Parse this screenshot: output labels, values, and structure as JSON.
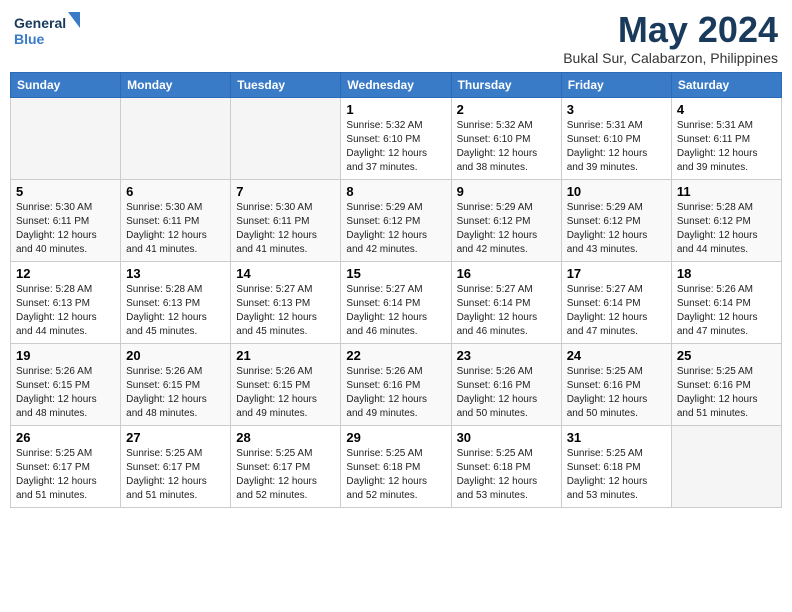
{
  "header": {
    "logo_line1": "General",
    "logo_line2": "Blue",
    "month_title": "May 2024",
    "location": "Bukal Sur, Calabarzon, Philippines"
  },
  "weekdays": [
    "Sunday",
    "Monday",
    "Tuesday",
    "Wednesday",
    "Thursday",
    "Friday",
    "Saturday"
  ],
  "weeks": [
    [
      {
        "day": "",
        "sunrise": "",
        "sunset": "",
        "daylight": "",
        "empty": true
      },
      {
        "day": "",
        "sunrise": "",
        "sunset": "",
        "daylight": "",
        "empty": true
      },
      {
        "day": "",
        "sunrise": "",
        "sunset": "",
        "daylight": "",
        "empty": true
      },
      {
        "day": "1",
        "sunrise": "Sunrise: 5:32 AM",
        "sunset": "Sunset: 6:10 PM",
        "daylight": "Daylight: 12 hours and 37 minutes."
      },
      {
        "day": "2",
        "sunrise": "Sunrise: 5:32 AM",
        "sunset": "Sunset: 6:10 PM",
        "daylight": "Daylight: 12 hours and 38 minutes."
      },
      {
        "day": "3",
        "sunrise": "Sunrise: 5:31 AM",
        "sunset": "Sunset: 6:10 PM",
        "daylight": "Daylight: 12 hours and 39 minutes."
      },
      {
        "day": "4",
        "sunrise": "Sunrise: 5:31 AM",
        "sunset": "Sunset: 6:11 PM",
        "daylight": "Daylight: 12 hours and 39 minutes."
      }
    ],
    [
      {
        "day": "5",
        "sunrise": "Sunrise: 5:30 AM",
        "sunset": "Sunset: 6:11 PM",
        "daylight": "Daylight: 12 hours and 40 minutes."
      },
      {
        "day": "6",
        "sunrise": "Sunrise: 5:30 AM",
        "sunset": "Sunset: 6:11 PM",
        "daylight": "Daylight: 12 hours and 41 minutes."
      },
      {
        "day": "7",
        "sunrise": "Sunrise: 5:30 AM",
        "sunset": "Sunset: 6:11 PM",
        "daylight": "Daylight: 12 hours and 41 minutes."
      },
      {
        "day": "8",
        "sunrise": "Sunrise: 5:29 AM",
        "sunset": "Sunset: 6:12 PM",
        "daylight": "Daylight: 12 hours and 42 minutes."
      },
      {
        "day": "9",
        "sunrise": "Sunrise: 5:29 AM",
        "sunset": "Sunset: 6:12 PM",
        "daylight": "Daylight: 12 hours and 42 minutes."
      },
      {
        "day": "10",
        "sunrise": "Sunrise: 5:29 AM",
        "sunset": "Sunset: 6:12 PM",
        "daylight": "Daylight: 12 hours and 43 minutes."
      },
      {
        "day": "11",
        "sunrise": "Sunrise: 5:28 AM",
        "sunset": "Sunset: 6:12 PM",
        "daylight": "Daylight: 12 hours and 44 minutes."
      }
    ],
    [
      {
        "day": "12",
        "sunrise": "Sunrise: 5:28 AM",
        "sunset": "Sunset: 6:13 PM",
        "daylight": "Daylight: 12 hours and 44 minutes."
      },
      {
        "day": "13",
        "sunrise": "Sunrise: 5:28 AM",
        "sunset": "Sunset: 6:13 PM",
        "daylight": "Daylight: 12 hours and 45 minutes."
      },
      {
        "day": "14",
        "sunrise": "Sunrise: 5:27 AM",
        "sunset": "Sunset: 6:13 PM",
        "daylight": "Daylight: 12 hours and 45 minutes."
      },
      {
        "day": "15",
        "sunrise": "Sunrise: 5:27 AM",
        "sunset": "Sunset: 6:14 PM",
        "daylight": "Daylight: 12 hours and 46 minutes."
      },
      {
        "day": "16",
        "sunrise": "Sunrise: 5:27 AM",
        "sunset": "Sunset: 6:14 PM",
        "daylight": "Daylight: 12 hours and 46 minutes."
      },
      {
        "day": "17",
        "sunrise": "Sunrise: 5:27 AM",
        "sunset": "Sunset: 6:14 PM",
        "daylight": "Daylight: 12 hours and 47 minutes."
      },
      {
        "day": "18",
        "sunrise": "Sunrise: 5:26 AM",
        "sunset": "Sunset: 6:14 PM",
        "daylight": "Daylight: 12 hours and 47 minutes."
      }
    ],
    [
      {
        "day": "19",
        "sunrise": "Sunrise: 5:26 AM",
        "sunset": "Sunset: 6:15 PM",
        "daylight": "Daylight: 12 hours and 48 minutes."
      },
      {
        "day": "20",
        "sunrise": "Sunrise: 5:26 AM",
        "sunset": "Sunset: 6:15 PM",
        "daylight": "Daylight: 12 hours and 48 minutes."
      },
      {
        "day": "21",
        "sunrise": "Sunrise: 5:26 AM",
        "sunset": "Sunset: 6:15 PM",
        "daylight": "Daylight: 12 hours and 49 minutes."
      },
      {
        "day": "22",
        "sunrise": "Sunrise: 5:26 AM",
        "sunset": "Sunset: 6:16 PM",
        "daylight": "Daylight: 12 hours and 49 minutes."
      },
      {
        "day": "23",
        "sunrise": "Sunrise: 5:26 AM",
        "sunset": "Sunset: 6:16 PM",
        "daylight": "Daylight: 12 hours and 50 minutes."
      },
      {
        "day": "24",
        "sunrise": "Sunrise: 5:25 AM",
        "sunset": "Sunset: 6:16 PM",
        "daylight": "Daylight: 12 hours and 50 minutes."
      },
      {
        "day": "25",
        "sunrise": "Sunrise: 5:25 AM",
        "sunset": "Sunset: 6:16 PM",
        "daylight": "Daylight: 12 hours and 51 minutes."
      }
    ],
    [
      {
        "day": "26",
        "sunrise": "Sunrise: 5:25 AM",
        "sunset": "Sunset: 6:17 PM",
        "daylight": "Daylight: 12 hours and 51 minutes."
      },
      {
        "day": "27",
        "sunrise": "Sunrise: 5:25 AM",
        "sunset": "Sunset: 6:17 PM",
        "daylight": "Daylight: 12 hours and 51 minutes."
      },
      {
        "day": "28",
        "sunrise": "Sunrise: 5:25 AM",
        "sunset": "Sunset: 6:17 PM",
        "daylight": "Daylight: 12 hours and 52 minutes."
      },
      {
        "day": "29",
        "sunrise": "Sunrise: 5:25 AM",
        "sunset": "Sunset: 6:18 PM",
        "daylight": "Daylight: 12 hours and 52 minutes."
      },
      {
        "day": "30",
        "sunrise": "Sunrise: 5:25 AM",
        "sunset": "Sunset: 6:18 PM",
        "daylight": "Daylight: 12 hours and 53 minutes."
      },
      {
        "day": "31",
        "sunrise": "Sunrise: 5:25 AM",
        "sunset": "Sunset: 6:18 PM",
        "daylight": "Daylight: 12 hours and 53 minutes."
      },
      {
        "day": "",
        "sunrise": "",
        "sunset": "",
        "daylight": "",
        "empty": true
      }
    ]
  ]
}
